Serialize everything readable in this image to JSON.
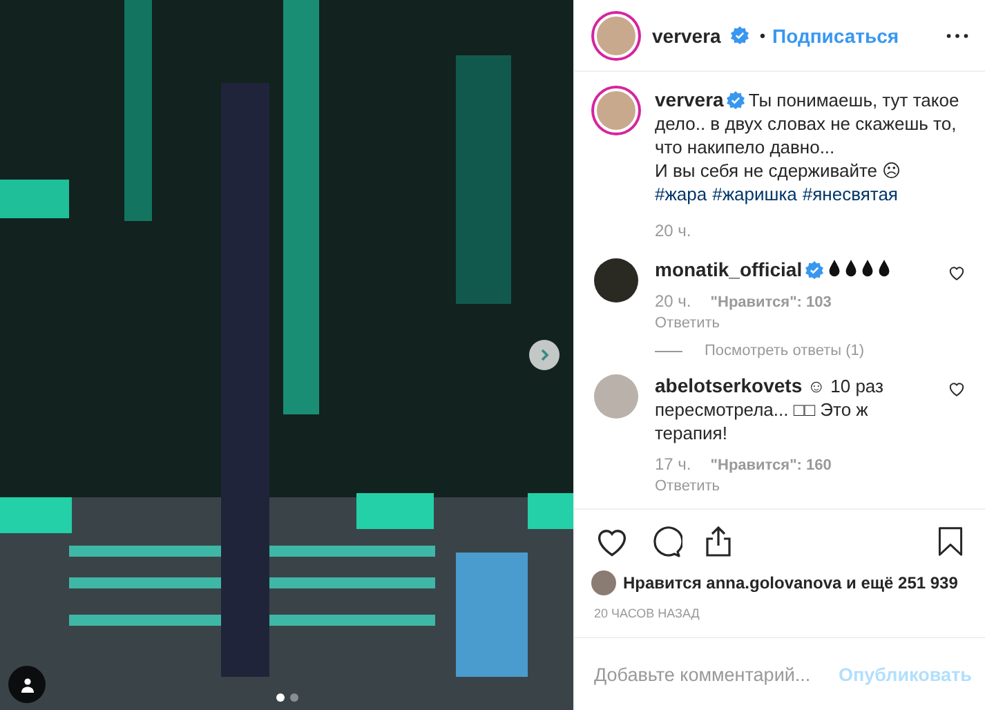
{
  "photo": {
    "carousel_dots": [
      {
        "selected": true
      },
      {
        "selected": false
      }
    ]
  },
  "header": {
    "username": "ververa",
    "verified": true,
    "separator": "•",
    "follow": "Подписаться"
  },
  "caption": {
    "username": "ververa",
    "verified": true,
    "text": "Ты понимаешь, тут такое дело.. в двух словах не скажешь то, что накипело давно...\nИ вы себя не сдерживайте ☹",
    "hashtags": [
      "#жара",
      "#жаришка",
      "#янесвятая"
    ],
    "time": "20 ч."
  },
  "comments": [
    {
      "username": "monatik_official",
      "verified": true,
      "kind": "drops",
      "time": "20 ч.",
      "likes": "\"Нравится\": 103",
      "reply": "Ответить",
      "view_replies": "Посмотреть ответы (1)"
    },
    {
      "username": "abelotserkovets",
      "verified": false,
      "kind": "text",
      "text": "☺ 10 раз пересмотрела... □□ Это ж терапия!",
      "time": "17 ч.",
      "likes": "\"Нравится\": 160",
      "reply": "Ответить"
    }
  ],
  "likes": "Нравится anna.golovanova и ещё 251 939",
  "date": "20 ЧАСОВ НАЗАД",
  "add_comment": {
    "placeholder": "Добавьте комментарий...",
    "publish": "Опубликовать",
    "disabled": true
  }
}
